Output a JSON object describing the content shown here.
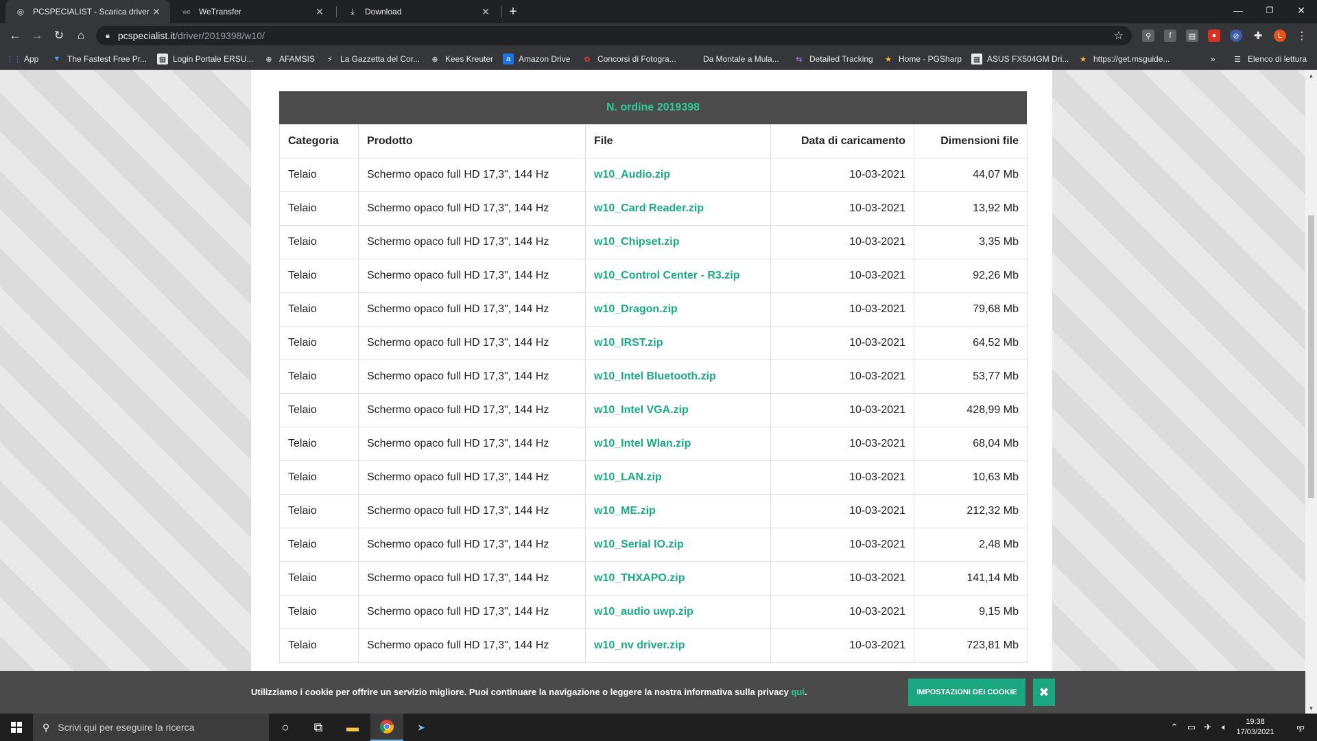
{
  "browser": {
    "tabs": [
      {
        "title": "PCSPECIALIST - Scarica driver",
        "active": true
      },
      {
        "title": "WeTransfer",
        "active": false
      },
      {
        "title": "Download",
        "active": false
      }
    ],
    "url_host": "pcspecialist.it",
    "url_path": "/driver/2019398/w10/",
    "bookmarks": [
      {
        "label": "App",
        "icon": "apps-grid-icon"
      },
      {
        "label": "The Fastest Free Pr...",
        "icon": "shield-icon"
      },
      {
        "label": "Login Portale ERSU...",
        "icon": "page-icon"
      },
      {
        "label": "AFAMSIS",
        "icon": "globe-icon"
      },
      {
        "label": "La Gazzetta del Cor...",
        "icon": "feather-icon"
      },
      {
        "label": "Kees Kreuter",
        "icon": "globe-icon"
      },
      {
        "label": "Amazon Drive",
        "icon": "amazon-icon"
      },
      {
        "label": "Concorsi di Fotogra...",
        "icon": "flower-icon"
      },
      {
        "label": "Da Montale a Mula...",
        "icon": "page-icon"
      },
      {
        "label": "Detailed Tracking",
        "icon": "truck-icon"
      },
      {
        "label": "Home - PGSharp",
        "icon": "star-icon"
      },
      {
        "label": "ASUS FX504GM Dri...",
        "icon": "page-icon"
      },
      {
        "label": "https://get.msguide...",
        "icon": "star-icon"
      }
    ],
    "reading_list": "Elenco di lettura",
    "profile_initial": "L"
  },
  "table": {
    "order_title": "N. ordine 2019398",
    "headers": [
      "Categoria",
      "Prodotto",
      "File",
      "Data di caricamento",
      "Dimensioni file"
    ],
    "rows": [
      {
        "categoria": "Telaio",
        "prodotto": "Schermo opaco full HD 17,3\", 144 Hz",
        "file": "w10_Audio.zip",
        "data": "10-03-2021",
        "dim": "44,07 Mb"
      },
      {
        "categoria": "Telaio",
        "prodotto": "Schermo opaco full HD 17,3\", 144 Hz",
        "file": "w10_Card Reader.zip",
        "data": "10-03-2021",
        "dim": "13,92 Mb"
      },
      {
        "categoria": "Telaio",
        "prodotto": "Schermo opaco full HD 17,3\", 144 Hz",
        "file": "w10_Chipset.zip",
        "data": "10-03-2021",
        "dim": "3,35 Mb"
      },
      {
        "categoria": "Telaio",
        "prodotto": "Schermo opaco full HD 17,3\", 144 Hz",
        "file": "w10_Control Center - R3.zip",
        "data": "10-03-2021",
        "dim": "92,26 Mb"
      },
      {
        "categoria": "Telaio",
        "prodotto": "Schermo opaco full HD 17,3\", 144 Hz",
        "file": "w10_Dragon.zip",
        "data": "10-03-2021",
        "dim": "79,68 Mb"
      },
      {
        "categoria": "Telaio",
        "prodotto": "Schermo opaco full HD 17,3\", 144 Hz",
        "file": "w10_IRST.zip",
        "data": "10-03-2021",
        "dim": "64,52 Mb"
      },
      {
        "categoria": "Telaio",
        "prodotto": "Schermo opaco full HD 17,3\", 144 Hz",
        "file": "w10_Intel Bluetooth.zip",
        "data": "10-03-2021",
        "dim": "53,77 Mb"
      },
      {
        "categoria": "Telaio",
        "prodotto": "Schermo opaco full HD 17,3\", 144 Hz",
        "file": "w10_Intel VGA.zip",
        "data": "10-03-2021",
        "dim": "428,99 Mb"
      },
      {
        "categoria": "Telaio",
        "prodotto": "Schermo opaco full HD 17,3\", 144 Hz",
        "file": "w10_Intel Wlan.zip",
        "data": "10-03-2021",
        "dim": "68,04 Mb"
      },
      {
        "categoria": "Telaio",
        "prodotto": "Schermo opaco full HD 17,3\", 144 Hz",
        "file": "w10_LAN.zip",
        "data": "10-03-2021",
        "dim": "10,63 Mb"
      },
      {
        "categoria": "Telaio",
        "prodotto": "Schermo opaco full HD 17,3\", 144 Hz",
        "file": "w10_ME.zip",
        "data": "10-03-2021",
        "dim": "212,32 Mb"
      },
      {
        "categoria": "Telaio",
        "prodotto": "Schermo opaco full HD 17,3\", 144 Hz",
        "file": "w10_Serial IO.zip",
        "data": "10-03-2021",
        "dim": "2,48 Mb"
      },
      {
        "categoria": "Telaio",
        "prodotto": "Schermo opaco full HD 17,3\", 144 Hz",
        "file": "w10_THXAPO.zip",
        "data": "10-03-2021",
        "dim": "141,14 Mb"
      },
      {
        "categoria": "Telaio",
        "prodotto": "Schermo opaco full HD 17,3\", 144 Hz",
        "file": "w10_audio uwp.zip",
        "data": "10-03-2021",
        "dim": "9,15 Mb"
      },
      {
        "categoria": "Telaio",
        "prodotto": "Schermo opaco full HD 17,3\", 144 Hz",
        "file": "w10_nv driver.zip",
        "data": "10-03-2021",
        "dim": "723,81 Mb"
      }
    ]
  },
  "cookie_banner": {
    "message": "Utilizziamo i cookie per offrire un servizio migliore. Puoi continuare la navigazione o leggere la nostra informativa sulla privacy",
    "link": "qui",
    "suffix": ".",
    "settings_button": "IMPOSTAZIONI DEI COOKIE",
    "close_glyph": "✖"
  },
  "taskbar": {
    "search_placeholder": "Scrivi qui per eseguire la ricerca",
    "time": "19:38",
    "date": "17/03/2021",
    "notification_count": "1"
  },
  "colors": {
    "accent_green": "#1aa67e",
    "link_green": "#1aaa84",
    "header_bg": "#4b4b4b",
    "chrome_dark": "#202124",
    "chrome_toolbar": "#35363a",
    "profile_orange": "#e8501e"
  }
}
